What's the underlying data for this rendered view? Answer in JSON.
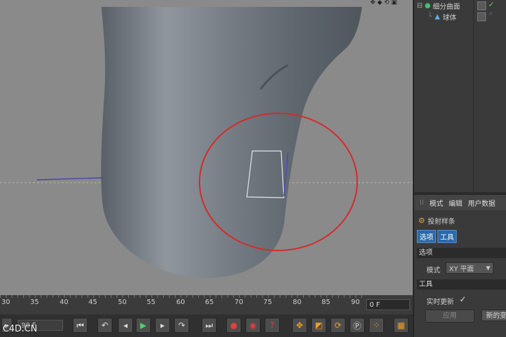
{
  "object_manager": {
    "items": [
      {
        "label": "细分曲面",
        "icon": "subdivision-surface-icon"
      },
      {
        "label": "球体",
        "icon": "sphere-icon"
      }
    ]
  },
  "attributes": {
    "tabs": [
      "模式",
      "编辑",
      "用户数据"
    ],
    "object_name": "投射样条",
    "subtabs": [
      "选项",
      "工具"
    ],
    "section_options": "选项",
    "mode_label": "模式",
    "mode_value": "XY 平面",
    "section_tool": "工具",
    "realtime_label": "实时更新",
    "realtime_check": "✓",
    "apply_label": "应用",
    "new_label": "新的变"
  },
  "timeline": {
    "ticks": [
      "30",
      "35",
      "40",
      "45",
      "50",
      "55",
      "60",
      "65",
      "70",
      "75",
      "80",
      "85",
      "90"
    ],
    "current_frame": "0 F"
  },
  "transport": {
    "end_field": "90 F"
  },
  "watermark": "C4D.CN",
  "colors": {
    "highlight_circle": "#d42a2a",
    "viewport_bg": "#8a8a8a",
    "mesh": "#6b7580"
  }
}
